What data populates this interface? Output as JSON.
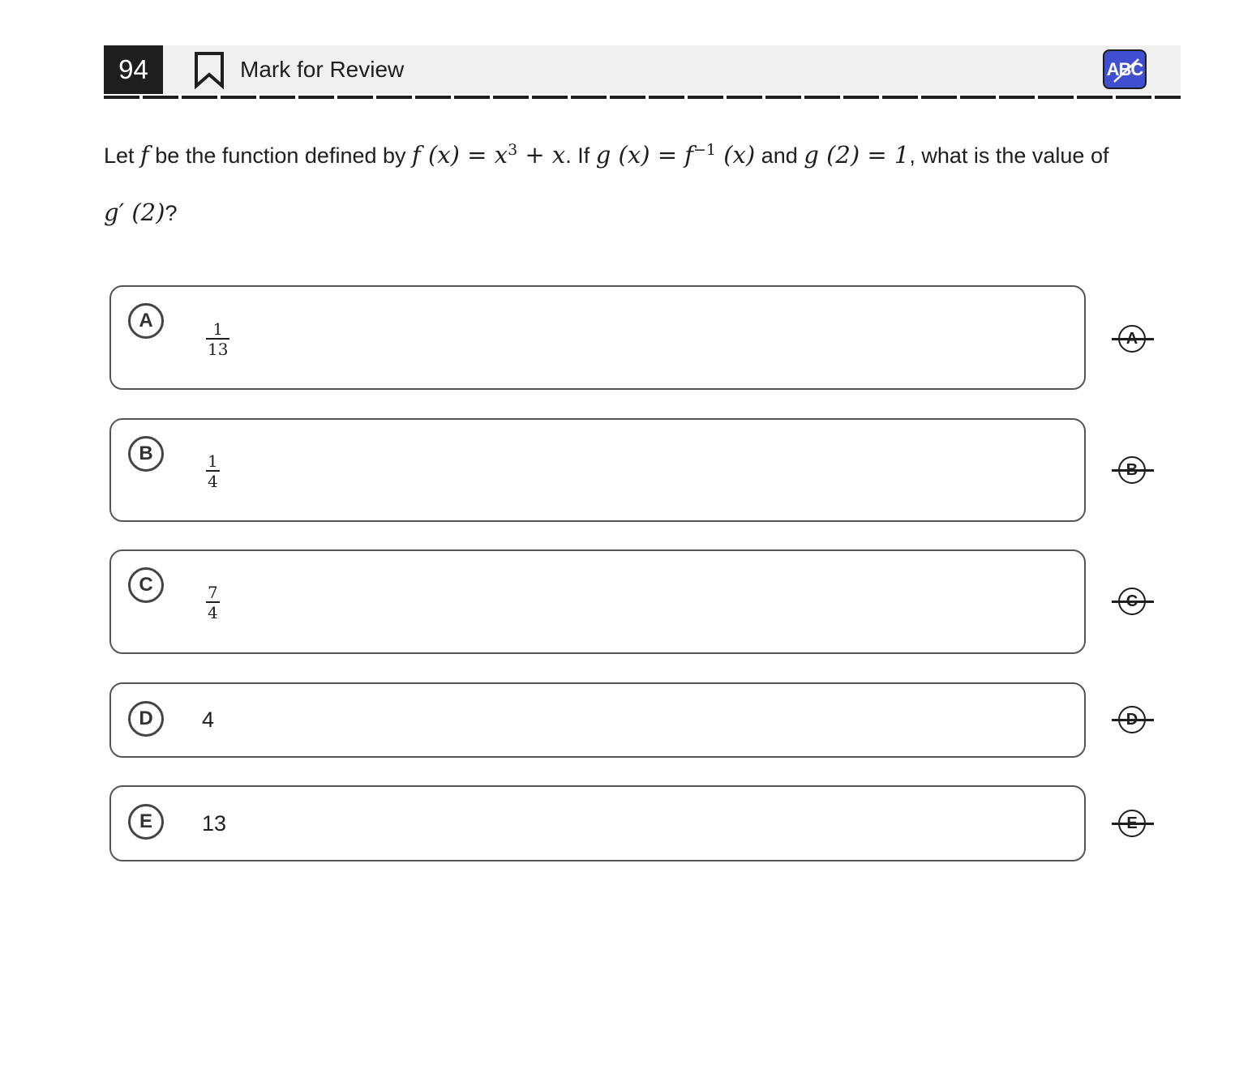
{
  "header": {
    "question_number": "94",
    "mark_for_review_label": "Mark for Review",
    "abc_label": "ABC",
    "accent_color": "#3f4fcf"
  },
  "question": {
    "p1": "Let ",
    "f": "f",
    "p2": " be the function defined by ",
    "math1": "f (x) = x",
    "math1_sup": "3",
    "math1_tail": " + x",
    "p3": ". If ",
    "math2": "g (x) = f",
    "math2_sup": "−1",
    "math2_tail": " (x)",
    "p4": " and ",
    "math3": "g (2) = 1",
    "p5": ", what is the value of",
    "math4": "g′ (2)",
    "p6": "?"
  },
  "choices": [
    {
      "letter": "A",
      "numerator": "1",
      "denominator": "13"
    },
    {
      "letter": "B",
      "numerator": "1",
      "denominator": "4"
    },
    {
      "letter": "C",
      "numerator": "7",
      "denominator": "4"
    },
    {
      "letter": "D",
      "value": "4"
    },
    {
      "letter": "E",
      "value": "13"
    }
  ]
}
